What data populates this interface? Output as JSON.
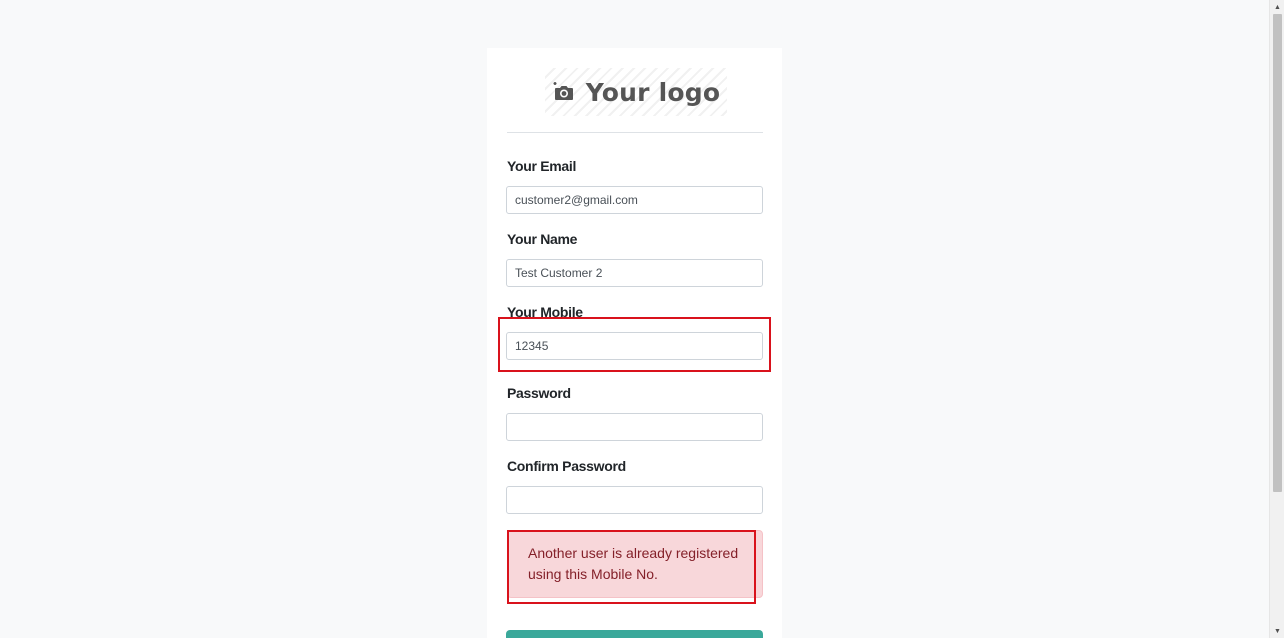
{
  "logo": {
    "text": "Your logo",
    "icon": "camera-plus-icon"
  },
  "form": {
    "email_label": "Your Email",
    "email_value": "customer2@gmail.com",
    "name_label": "Your Name",
    "name_value": "Test Customer 2",
    "mobile_label": "Your Mobile",
    "mobile_value": "12345",
    "password_label": "Password",
    "password_value": "",
    "confirm_password_label": "Confirm Password",
    "confirm_password_value": ""
  },
  "alert": {
    "message": "Another user is already registered using this Mobile No."
  },
  "colors": {
    "page_background": "#f8f9fa",
    "alert_background": "#f8d7da",
    "alert_text": "#842029",
    "annotation_box": "#d9121c",
    "submit_button": "#3aa89a"
  }
}
